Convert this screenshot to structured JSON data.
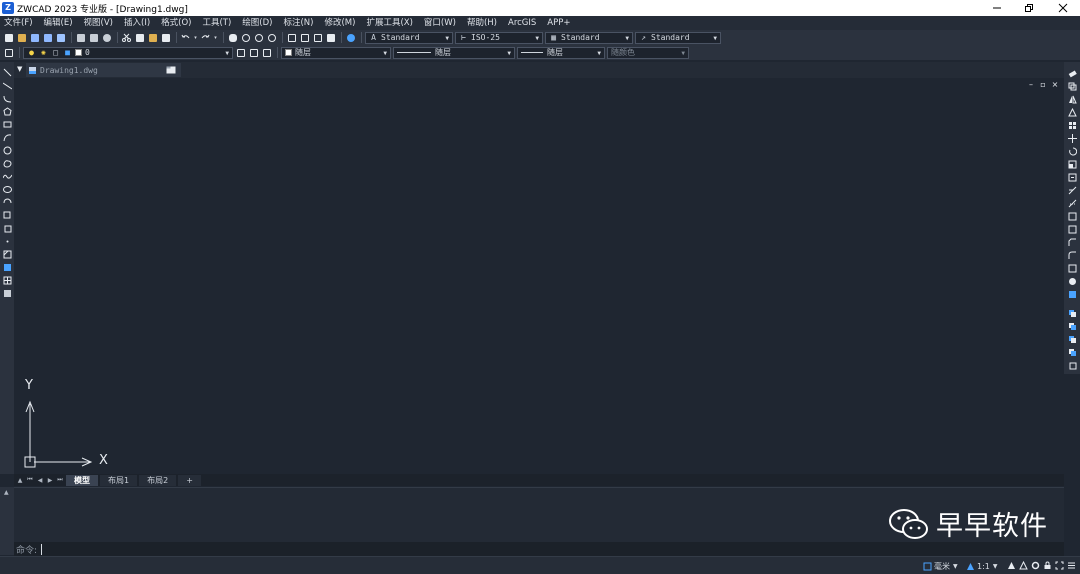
{
  "window": {
    "title": "ZWCAD 2023 专业版 - [Drawing1.dwg]",
    "app_icon_letter": "Z",
    "controls": [
      "minimize",
      "restore",
      "close"
    ]
  },
  "menu": {
    "items": [
      "文件(F)",
      "编辑(E)",
      "视图(V)",
      "插入(I)",
      "格式(O)",
      "工具(T)",
      "绘图(D)",
      "标注(N)",
      "修改(M)",
      "扩展工具(X)",
      "窗口(W)",
      "帮助(H)",
      "ArcGIS",
      "APP+"
    ]
  },
  "toolbar_styles": {
    "text_style": "Standard",
    "dim_style": "ISO-25",
    "table_style": "Standard",
    "multileader_style": "Standard"
  },
  "layer_toolbar": {
    "current_layer": "0",
    "color": "随层",
    "linetype": "随层",
    "lineweight": "随层",
    "plot_style": "随颜色"
  },
  "document": {
    "tab_label": "Drawing1.dwg"
  },
  "canvas_controls": {
    "minimize": "–",
    "restore": "▫",
    "close": "×"
  },
  "ucs": {
    "x_label": "X",
    "y_label": "Y"
  },
  "layout_tabs": {
    "tabs": [
      "模型",
      "布局1",
      "布局2"
    ],
    "active": "模型",
    "add": "+"
  },
  "command": {
    "prompt": "命令:"
  },
  "watermark": {
    "text": "早早软件"
  },
  "status_bar": {
    "units": "毫米",
    "annotation_scale": "1:1"
  },
  "colors": {
    "background": "#1f2631",
    "toolbar": "#2b323e",
    "accent_blue": "#4aa3ff"
  }
}
